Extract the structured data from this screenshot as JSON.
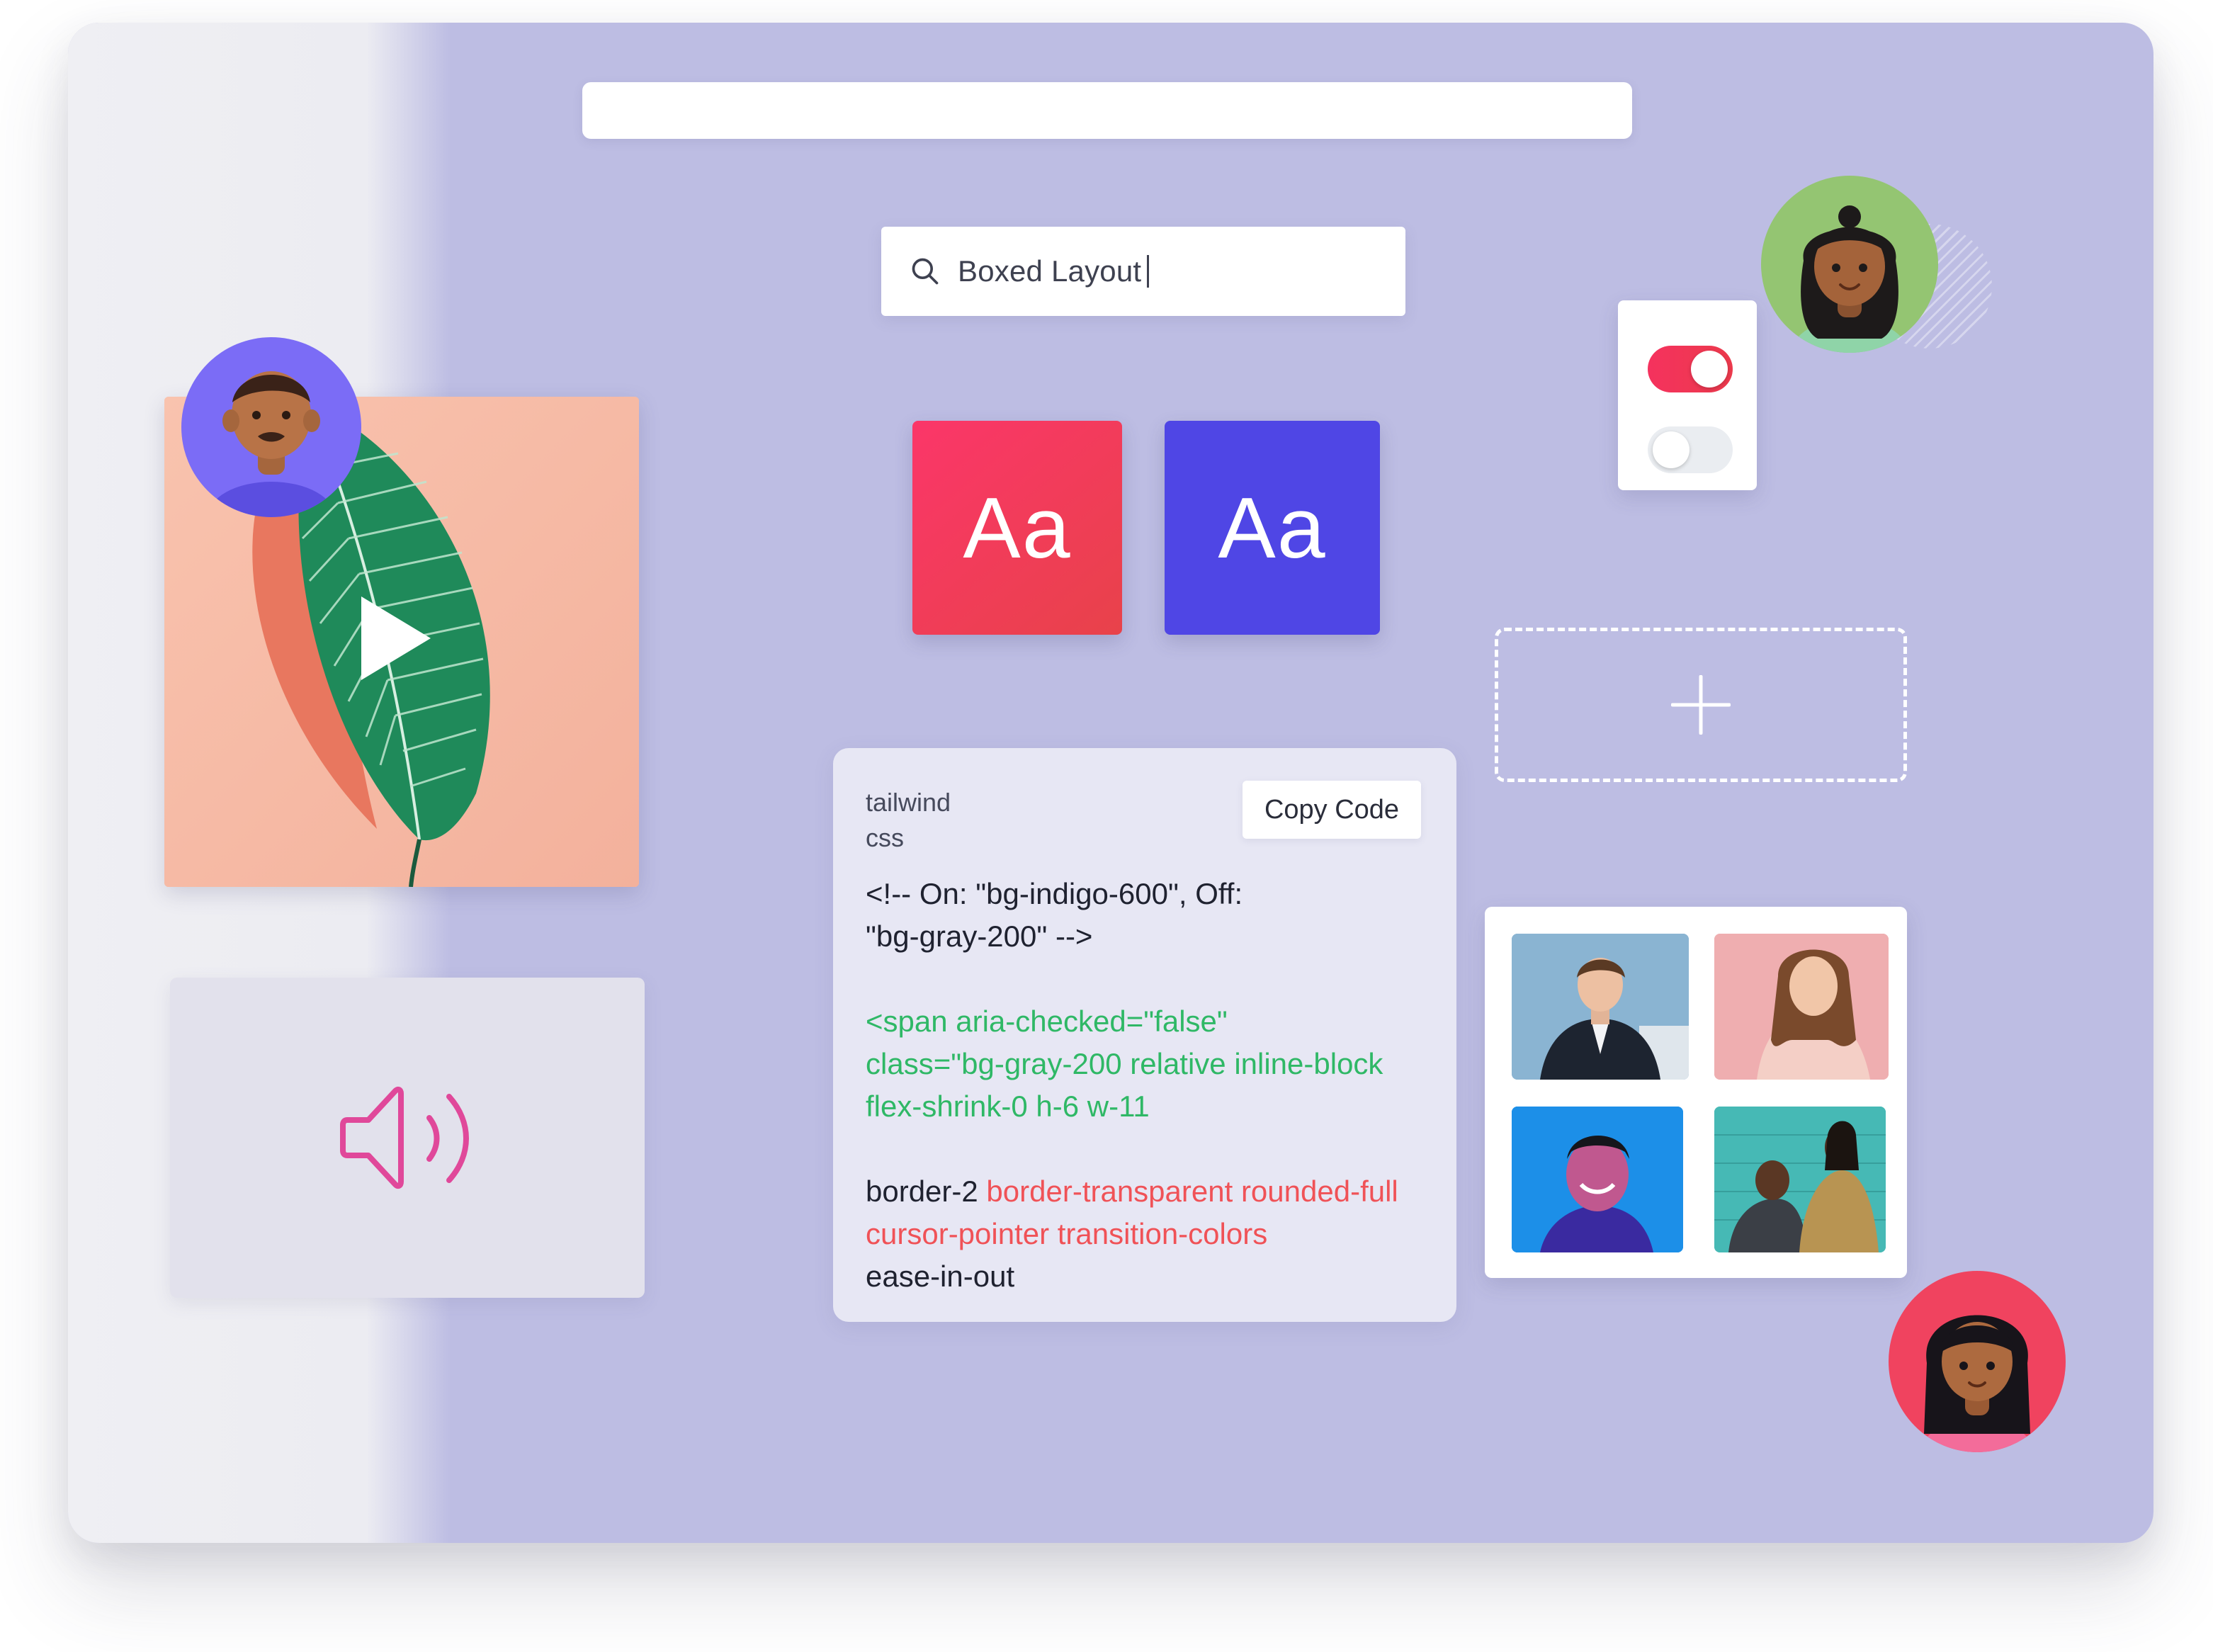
{
  "search": {
    "query": "Boxed Layout"
  },
  "font_tiles": [
    {
      "label": "Aa",
      "color": "#f43f5e"
    },
    {
      "label": "Aa",
      "color": "#4f46e5"
    }
  ],
  "code_card": {
    "language_line1": "tailwind",
    "language_line2": "css",
    "copy_label": "Copy Code",
    "lines": {
      "l1": "<!-- On: \"bg-indigo-600\", Off:",
      "l2": "\"bg-gray-200\" -->",
      "l3": "<span aria-checked=\"false\"",
      "l4": "class=\"bg-gray-200 relative inline-block",
      "l5": "flex-shrink-0 h-6 w-11",
      "l6a": "border-2 ",
      "l6b": "border-transparent rounded-full",
      "l7": "cursor-pointer transition-colors",
      "l8": "ease-in-out"
    }
  },
  "toggles": [
    {
      "state": "on",
      "color": "#f43f5e"
    },
    {
      "state": "off",
      "color": "#e5e7eb"
    }
  ],
  "colors": {
    "canvas": "#bdbde3",
    "accent_red": "#f43f5e",
    "accent_indigo": "#4f46e5",
    "code_green": "#2fb866",
    "code_red": "#f05257",
    "speaker_pink": "#e0489a"
  },
  "icons": [
    "search-icon",
    "play-icon",
    "speaker-icon",
    "plus-icon"
  ]
}
